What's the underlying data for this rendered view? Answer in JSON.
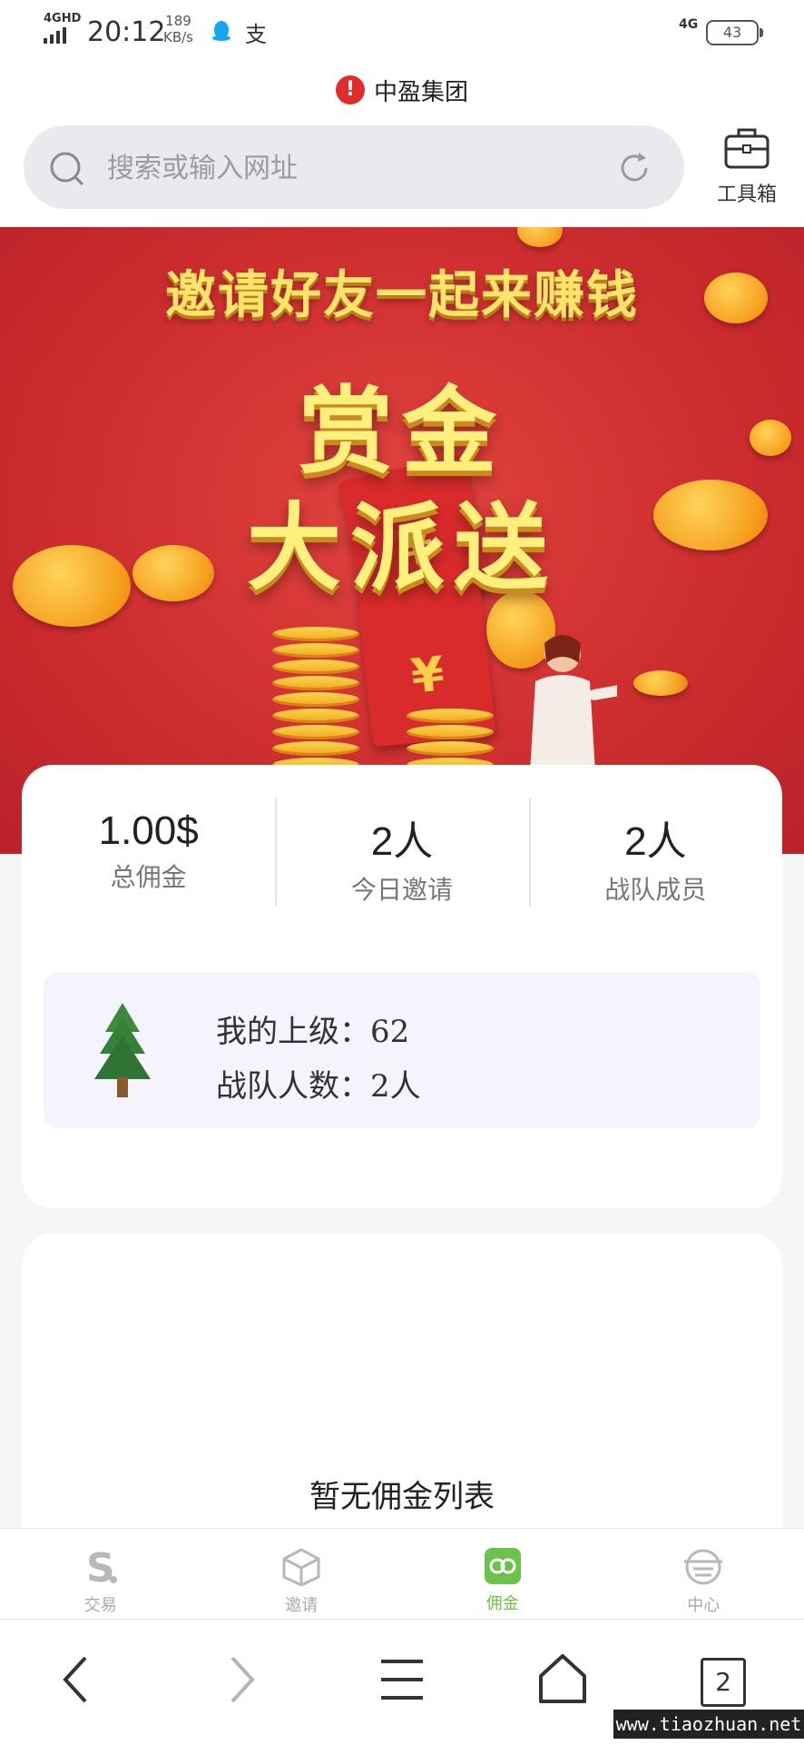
{
  "status_bar": {
    "network_type": "4GHD",
    "time": "20:12",
    "speed_value": "189",
    "speed_unit": "KB/s",
    "alipay_glyph": "支",
    "cell_network": "4G",
    "battery": "43"
  },
  "browser": {
    "site_name": "中盈集团",
    "search_placeholder": "搜索或输入网址",
    "toolbox_label": "工具箱",
    "tab_count": "2"
  },
  "banner": {
    "headline": "邀请好友一起来赚钱",
    "line1": "赏金",
    "line2": "大派送"
  },
  "stats": [
    {
      "value": "1.00$",
      "label": "总佣金"
    },
    {
      "value": "2人",
      "label": "今日邀请"
    },
    {
      "value": "2人",
      "label": "战队成员"
    }
  ],
  "team": {
    "superior_label": "我的上级：",
    "superior_value": "62",
    "size_label": "战队人数：",
    "size_value": "2人"
  },
  "commission_list": {
    "empty_message": "暂无佣金列表"
  },
  "tabbar": {
    "active_index": 2,
    "items": [
      {
        "label": "交易",
        "icon": "trade-s-icon"
      },
      {
        "label": "邀请",
        "icon": "cube-icon"
      },
      {
        "label": "佣金",
        "icon": "commission-icon"
      },
      {
        "label": "中心",
        "icon": "center-icon"
      }
    ],
    "active_color": "#6cc24a"
  },
  "watermark": "www.tiaozhuan.net",
  "colors": {
    "banner_red": "#cc2c2e",
    "gold": "#ffe36a",
    "alert_red": "#e02c2c"
  }
}
